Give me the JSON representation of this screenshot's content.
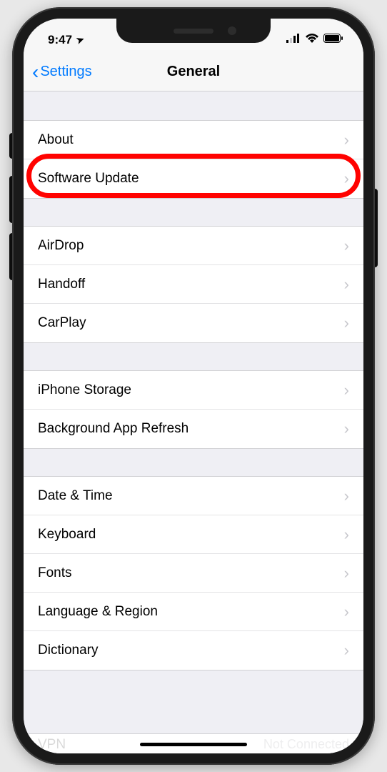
{
  "statusBar": {
    "time": "9:47",
    "locationGlyph": "➤"
  },
  "nav": {
    "backLabel": "Settings",
    "title": "General"
  },
  "sections": [
    {
      "items": [
        {
          "key": "about",
          "label": "About"
        },
        {
          "key": "software-update",
          "label": "Software Update",
          "highlighted": true
        }
      ]
    },
    {
      "items": [
        {
          "key": "airdrop",
          "label": "AirDrop"
        },
        {
          "key": "handoff",
          "label": "Handoff"
        },
        {
          "key": "carplay",
          "label": "CarPlay"
        }
      ]
    },
    {
      "items": [
        {
          "key": "iphone-storage",
          "label": "iPhone Storage"
        },
        {
          "key": "background-app-refresh",
          "label": "Background App Refresh"
        }
      ]
    },
    {
      "items": [
        {
          "key": "date-time",
          "label": "Date & Time"
        },
        {
          "key": "keyboard",
          "label": "Keyboard"
        },
        {
          "key": "fonts",
          "label": "Fonts"
        },
        {
          "key": "language-region",
          "label": "Language & Region"
        },
        {
          "key": "dictionary",
          "label": "Dictionary"
        }
      ]
    }
  ],
  "cutoff": {
    "label": "VPN",
    "value": "Not Connected"
  }
}
